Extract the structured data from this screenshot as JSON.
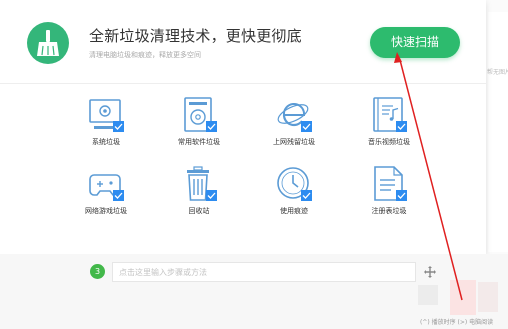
{
  "header": {
    "title": "全新垃圾清理技术，更快更彻底",
    "subtitle": "清理电脑垃圾和痕迹，释放更多空间",
    "scan_button": "快速扫描",
    "logo_icon": "broom-icon"
  },
  "categories": [
    {
      "label": "系统垃圾",
      "icon": "system-monitor-icon",
      "checked": true
    },
    {
      "label": "常用软件垃圾",
      "icon": "software-disc-icon",
      "checked": true
    },
    {
      "label": "上网残留垃圾",
      "icon": "browser-e-icon",
      "checked": true
    },
    {
      "label": "音乐视频垃圾",
      "icon": "music-file-icon",
      "checked": true
    },
    {
      "label": "网络游戏垃圾",
      "icon": "gamepad-icon",
      "checked": true
    },
    {
      "label": "回收站",
      "icon": "trash-bin-icon",
      "checked": true
    },
    {
      "label": "使用痕迹",
      "icon": "clock-icon",
      "checked": true
    },
    {
      "label": "注册表垃圾",
      "icon": "registry-doc-icon",
      "checked": true
    }
  ],
  "editor": {
    "step_number": "3",
    "step_placeholder": "点击这里输入步骤或方法"
  },
  "right_hint": "帮无图片",
  "footer": "(^) 播放时序  (>) 电脑阅读",
  "colors": {
    "accent_green": "#2dbb6e",
    "icon_blue": "#5b9bd5",
    "check_blue": "#2d8cf0",
    "arrow_red": "#e02020"
  }
}
